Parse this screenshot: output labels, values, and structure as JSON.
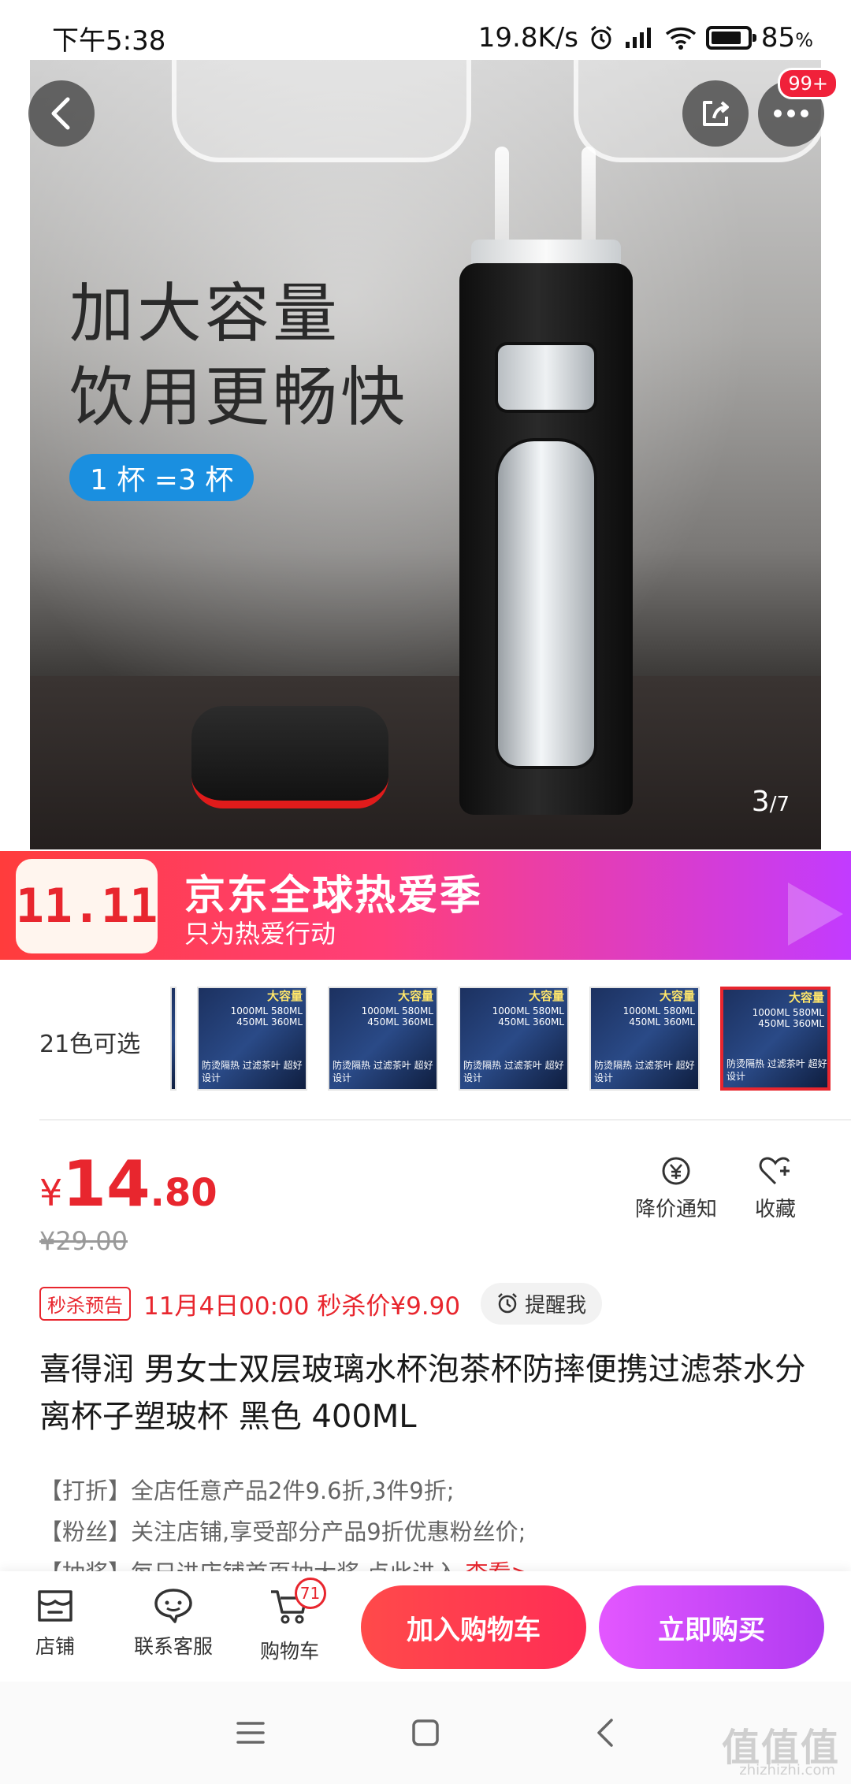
{
  "status_bar": {
    "time": "下午5:38",
    "network_speed": "19.8K/s",
    "battery": "85",
    "battery_unit": "%",
    "battery_level": 0.85
  },
  "hero": {
    "headline_line1": "加大容量",
    "headline_line2": "饮用更畅快",
    "cup_badge": "1 杯 =3 杯",
    "page_current": "3",
    "page_total": "/7",
    "notification_count": "99+"
  },
  "promo_banner": {
    "tag": "11.11",
    "title": "京东全球热爱季",
    "subtitle": "只为热爱行动"
  },
  "colors": {
    "label": "21色可选",
    "thumb_heading": "大容量",
    "thumb_sizes": "1000ML 580ML 450ML 360ML",
    "thumb_features": "防烫隔热 过滤茶叶 超好设计",
    "selected_index": 5
  },
  "price": {
    "symbol": "¥",
    "integer": "14",
    "decimal": ".80",
    "original": "¥29.00",
    "price_alert_label": "降价通知",
    "favorite_label": "收藏"
  },
  "flash_sale": {
    "tag": "秒杀预告",
    "info": "11月4日00:00 秒杀价¥9.90",
    "remind_label": "提醒我"
  },
  "product": {
    "title": "喜得润 男女士双层玻璃水杯泡茶杯防摔便携过滤茶水分离杯子塑玻杯 黑色 400ML"
  },
  "promotions": [
    {
      "text": "【打折】全店任意产品2件9.6折,3件9折;"
    },
    {
      "text": "【粉丝】关注店铺,享受部分产品9折优惠粉丝价;"
    },
    {
      "text": "【抽奖】每日进店铺首页抽大奖,点此进入",
      "link": "查看>"
    }
  ],
  "action_bar": {
    "shop_label": "店铺",
    "service_label": "联系客服",
    "cart_label": "购物车",
    "cart_count": "71",
    "add_to_cart": "加入购物车",
    "buy_now": "立即购买"
  },
  "watermark": {
    "logo": "值值值",
    "site": "zhizhizhi.com"
  },
  "colors_theme": {
    "accent": "#e8262e",
    "buy_gradient_end": "#b13bf2"
  }
}
